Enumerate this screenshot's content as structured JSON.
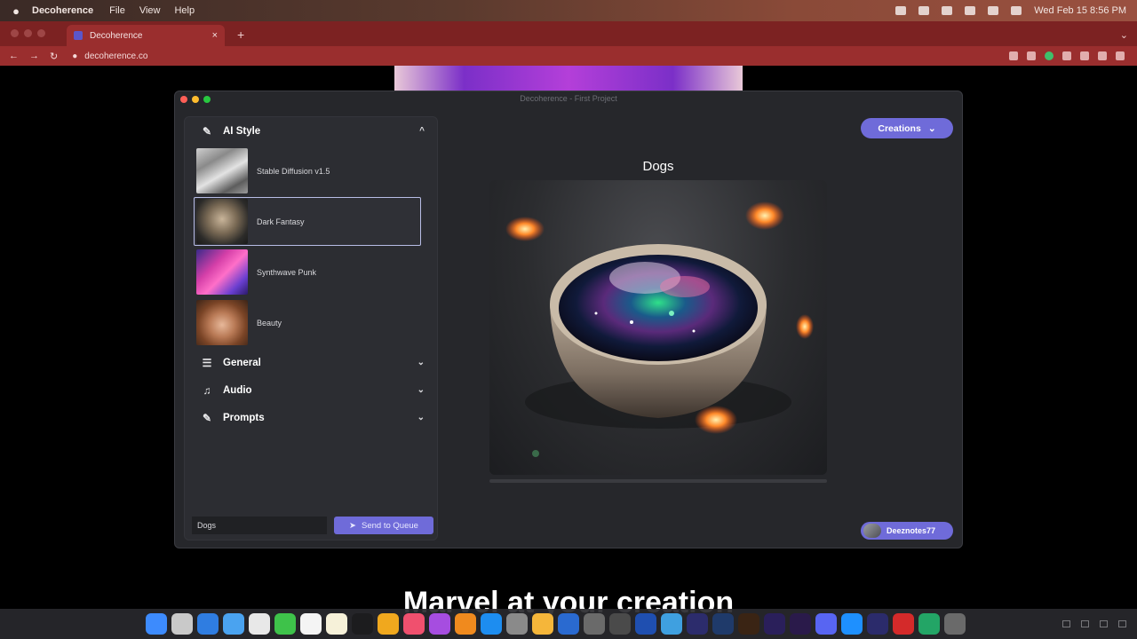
{
  "menubar": {
    "app": "Decoherence",
    "menus": [
      "File",
      "View",
      "Help"
    ],
    "datetime": "Wed Feb 15  8:56 PM"
  },
  "browser": {
    "tab_title": "Decoherence",
    "url": "decoherence.co"
  },
  "window": {
    "title": "Decoherence - First Project"
  },
  "sidebar": {
    "ai_style": {
      "label": "AI Style",
      "expanded": true,
      "items": [
        {
          "label": "Stable Diffusion v1.5",
          "selected": false
        },
        {
          "label": "Dark Fantasy",
          "selected": true
        },
        {
          "label": "Synthwave Punk",
          "selected": false
        },
        {
          "label": "Beauty",
          "selected": false
        }
      ]
    },
    "general": {
      "label": "General",
      "expanded": false
    },
    "audio": {
      "label": "Audio",
      "expanded": false
    },
    "prompts": {
      "label": "Prompts",
      "expanded": false
    }
  },
  "bottom": {
    "prompt_value": "Dogs",
    "send_label": "Send to Queue"
  },
  "main": {
    "creations_label": "Creations",
    "image_title": "Dogs",
    "progress": 0,
    "username": "Deeznotes77"
  },
  "page": {
    "overlay_text": "Marvel at your creation"
  },
  "colors": {
    "accent": "#6f6bd9",
    "browser_chrome": "#9a2e2e",
    "window_bg": "#26272b"
  }
}
